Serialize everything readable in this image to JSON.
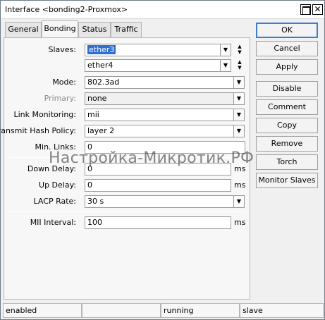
{
  "window": {
    "title": "Interface <bonding2-Proxmox>",
    "max_icon": "maximize-icon",
    "close_icon": "close-icon",
    "close_glyph": "✕"
  },
  "tabs": [
    {
      "label": "General",
      "active": false
    },
    {
      "label": "Bonding",
      "active": true
    },
    {
      "label": "Status",
      "active": false
    },
    {
      "label": "Traffic",
      "active": false
    }
  ],
  "form": {
    "slaves_label": "Slaves:",
    "slaves": [
      "ether3",
      "ether4"
    ],
    "mode_label": "Mode:",
    "mode": "802.3ad",
    "primary_label": "Primary:",
    "primary": "none",
    "link_monitoring_label": "Link Monitoring:",
    "link_monitoring": "mii",
    "hash_policy_label": "Transmit Hash Policy:",
    "hash_policy": "layer 2",
    "min_links_label": "Min. Links:",
    "min_links": "0",
    "down_delay_label": "Down Delay:",
    "down_delay": "0",
    "up_delay_label": "Up Delay:",
    "up_delay": "0",
    "lacp_rate_label": "LACP Rate:",
    "lacp_rate": "30 s",
    "mii_interval_label": "MII Interval:",
    "mii_interval": "100",
    "unit_ms": "ms",
    "dropdown_glyph": "▼",
    "up_glyph": "▲",
    "down_glyph": "▼"
  },
  "buttons": {
    "ok": "OK",
    "cancel": "Cancel",
    "apply": "Apply",
    "disable": "Disable",
    "comment": "Comment",
    "copy": "Copy",
    "remove": "Remove",
    "torch": "Torch",
    "monitor_slaves": "Monitor Slaves"
  },
  "status_bar": {
    "cell1": "enabled",
    "cell2": "",
    "cell3": "running",
    "cell4": "slave"
  },
  "watermark": "Настройка-Микротик.РФ",
  "colors": {
    "selection": "#2f6fd0",
    "ok_border": "#3d7bd4"
  }
}
